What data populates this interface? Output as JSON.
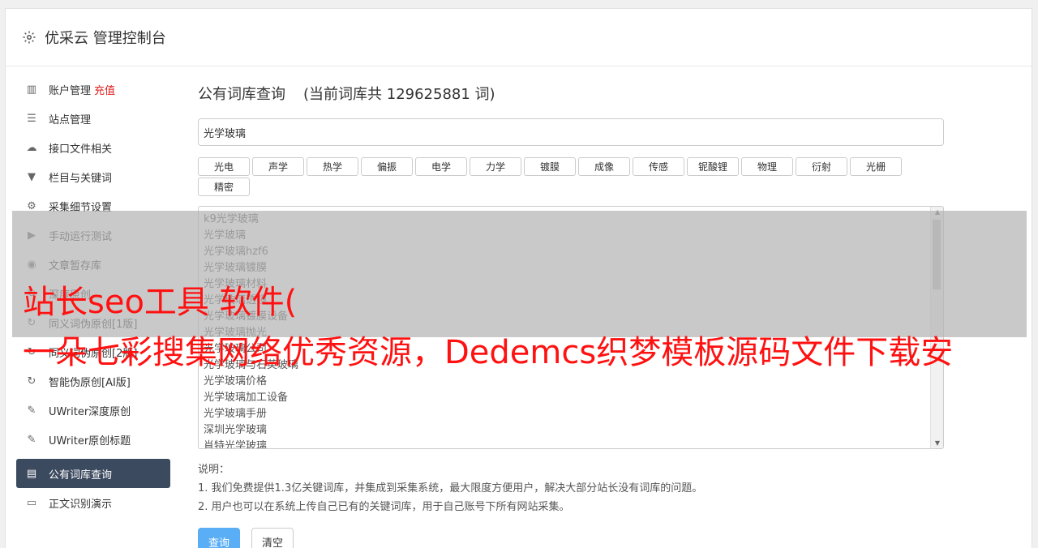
{
  "header": {
    "title": "优采云 管理控制台"
  },
  "sidebar": {
    "items": [
      {
        "label": "账户管理",
        "badge": "充值",
        "icon": "bar-chart-icon"
      },
      {
        "label": "站点管理",
        "icon": "server-icon"
      },
      {
        "label": "接口文件相关",
        "icon": "cloud-upload-icon"
      },
      {
        "label": "栏目与关键词",
        "icon": "filter-icon"
      },
      {
        "label": "采集细节设置",
        "icon": "gears-icon"
      },
      {
        "label": "手动运行测试",
        "icon": "play-icon"
      },
      {
        "label": "文章暂存库",
        "icon": "database-icon"
      },
      {
        "label": "深度原创",
        "icon": "refresh-icon"
      },
      {
        "label": "同义词伪原创[1版]",
        "icon": "refresh-icon"
      },
      {
        "label": "同义词伪原创[2版]",
        "icon": "refresh-icon"
      },
      {
        "label": "智能伪原创[AI版]",
        "icon": "refresh-icon"
      },
      {
        "label": "UWriter深度原创",
        "icon": "edit-icon"
      },
      {
        "label": "UWriter原创标题",
        "icon": "edit-icon"
      },
      {
        "label": "公有词库查询",
        "icon": "book-icon",
        "active": true
      },
      {
        "label": "正文识别演示",
        "icon": "monitor-icon"
      }
    ]
  },
  "main": {
    "title": "公有词库查询",
    "count_text": "(当前词库共 129625881 词)",
    "search_value": "光学玻璃",
    "tags": [
      "光电",
      "声学",
      "热学",
      "偏振",
      "电学",
      "力学",
      "镀膜",
      "成像",
      "传感",
      "铌酸锂",
      "物理",
      "衍射",
      "光栅",
      "精密"
    ],
    "results": [
      "k9光学玻璃",
      "光学玻璃",
      "光学玻璃hzf6",
      "光学玻璃镀膜",
      "光学玻璃材料",
      "光学玻璃透镜",
      "光学玻璃镀膜设备",
      "光学玻璃抛光",
      "光学玻璃公司",
      "光学玻璃与石英玻璃",
      "光学玻璃价格",
      "光学玻璃加工设备",
      "光学玻璃手册",
      "深圳光学玻璃",
      "肖特光学玻璃"
    ],
    "notes_title": "说明：",
    "notes": [
      "1. 我们免费提供1.3亿关键词库，并集成到采集系统，最大限度方便用户，解决大部分站长没有词库的问题。",
      "2. 用户也可以在系统上传自己已有的关键词库，用于自己账号下所有网站采集。"
    ],
    "query_button": "查询",
    "clear_button": "清空"
  },
  "overlay": {
    "line1": "站长seo工具 软件(",
    "line2": "一朵七彩搜集网络优秀资源，Dedemcs织梦模板源码文件下载安"
  },
  "colors": {
    "accent": "#5aaef5",
    "sidebar_active": "#3c4a5f",
    "overlay_text": "#ff1111"
  }
}
